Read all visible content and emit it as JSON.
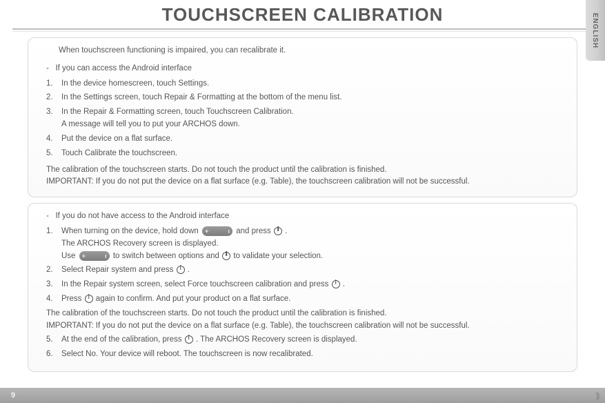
{
  "language_tab": "ENGLISH",
  "title": "TOUCHSCREEN CALIBRATION",
  "page_number": "9",
  "card1": {
    "intro": "When touchscreen functioning is impaired, you can recalibrate it.",
    "condition_dash": "-",
    "condition": "If you can access the Android interface",
    "steps": [
      {
        "n": "1.",
        "text": "In the device homescreen, touch Settings."
      },
      {
        "n": "2.",
        "text": "In the Settings screen, touch Repair & Formatting at the bottom of the menu list."
      },
      {
        "n": "3.",
        "text": "In the Repair & Formatting screen, touch Touchscreen Calibration.",
        "sub": "A message will tell you to put your ARCHOS down."
      },
      {
        "n": "4.",
        "text": "Put the device on a flat surface."
      },
      {
        "n": "5.",
        "text": "Touch Calibrate the touchscreen."
      }
    ],
    "note1": "The calibration of the touchscreen starts. Do not touch the product until the calibration is finished.",
    "note2": "IMPORTANT: If you do not put the device on a flat surface (e.g. Table), the touchscreen calibration will not be successful."
  },
  "card2": {
    "condition_dash": "-",
    "condition": "If you do not have access to the Android interface",
    "s1": {
      "n": "1.",
      "a": "When turning on the device, hold down ",
      "b": " and press ",
      "c": "."
    },
    "s1_sub1": "The ARCHOS Recovery screen is displayed.",
    "s1_sub2a": "Use ",
    "s1_sub2b": " to switch between options and ",
    "s1_sub2c": " to validate your selection.",
    "s2": {
      "n": "2.",
      "a": "Select Repair system and press ",
      "b": "."
    },
    "s3": {
      "n": "3.",
      "a": "In the Repair system screen, select Force touchscreen calibration and press ",
      "b": "."
    },
    "s4": {
      "n": "4.",
      "a": "Press ",
      "b": " again to confirm. And put your product on a flat surface."
    },
    "note1": "The calibration of the touchscreen starts. Do not touch the product until the calibration is finished.",
    "note2": "IMPORTANT: If you do not put the device on a flat surface (e.g. Table), the touchscreen calibration will not be successful.",
    "s5": {
      "n": "5.",
      "a": "At the end of the calibration, press ",
      "b": ". The ARCHOS Recovery screen is displayed."
    },
    "s6": {
      "n": "6.",
      "text": "Select No. Your device will reboot. The touchscreen is now recalibrated."
    }
  },
  "icons": {
    "rocker_plus": "+",
    "rocker_tick": "ı"
  }
}
